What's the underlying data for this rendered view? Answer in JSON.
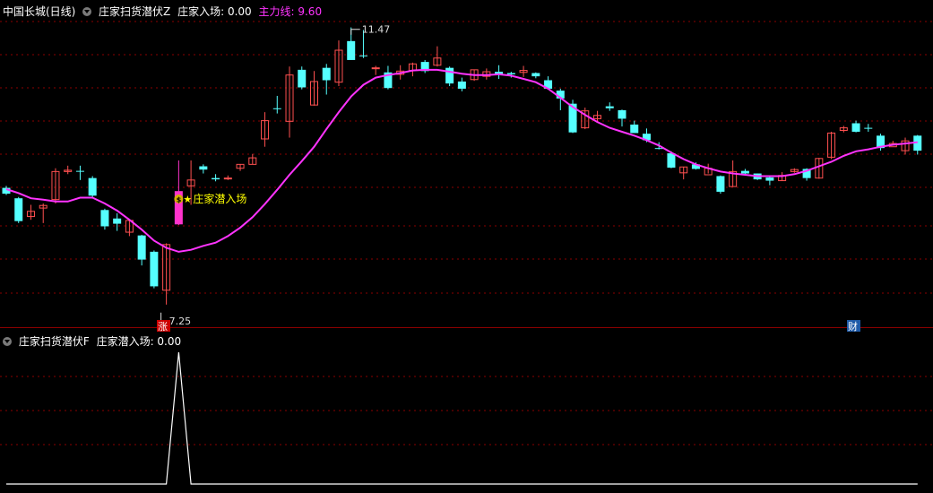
{
  "main_header": {
    "stock": "中国长城(日线)",
    "indicator": "庄家扫货潜伏Z",
    "entry_label": "庄家入场: 0.00",
    "mainline_label": "主力线: 9.60"
  },
  "sub_header": {
    "indicator": "庄家扫货潜伏F",
    "entry_label": "庄家潜入场: 0.00"
  },
  "markers": {
    "high_label": "11.47",
    "low_label": "7.25",
    "signal_label": "庄家潜入场",
    "star": "★",
    "money_glyph": "$",
    "zhang_badge": "涨",
    "cai_badge": "财"
  },
  "colors": {
    "background": "#000000",
    "grid": "#8b0000",
    "up": "#ff5050",
    "down": "#55ffff",
    "mainline": "#ff33ff",
    "signal_text": "#ffff00",
    "signal_candle": "#ff33cc",
    "sub_line": "#ffffff"
  },
  "chart_data": [
    {
      "type": "candlestick",
      "title": "中国长城(日线)",
      "y_range": [
        7.0,
        11.7
      ],
      "high_value": 11.47,
      "low_value": 7.25,
      "candles": [
        [
          9.04,
          8.95,
          9.07,
          8.93
        ],
        [
          8.88,
          8.53,
          8.9,
          8.5
        ],
        [
          8.6,
          8.68,
          8.78,
          8.55
        ],
        [
          8.73,
          8.77,
          8.8,
          8.5
        ],
        [
          8.86,
          9.29,
          9.34,
          8.8
        ],
        [
          9.29,
          9.31,
          9.38,
          9.25
        ],
        [
          9.3,
          9.29,
          9.38,
          9.16
        ],
        [
          9.19,
          8.92,
          9.22,
          8.9
        ],
        [
          8.7,
          8.45,
          8.72,
          8.4
        ],
        [
          8.57,
          8.49,
          8.65,
          8.38
        ],
        [
          8.36,
          8.54,
          8.55,
          8.3
        ],
        [
          8.31,
          7.94,
          8.32,
          7.85
        ],
        [
          8.06,
          7.53,
          8.08,
          7.5
        ],
        [
          7.47,
          8.17,
          8.19,
          7.25
        ],
        [
          8.48,
          8.99,
          9.46,
          8.47
        ],
        [
          9.07,
          9.16,
          9.46,
          8.78
        ],
        [
          9.37,
          9.32,
          9.4,
          9.26
        ],
        [
          9.19,
          9.17,
          9.25,
          9.14
        ],
        [
          9.19,
          9.19,
          9.23,
          9.16
        ],
        [
          9.34,
          9.4,
          9.4,
          9.3
        ],
        [
          9.4,
          9.5,
          9.56,
          9.4
        ],
        [
          9.79,
          10.07,
          10.2,
          9.67
        ],
        [
          10.26,
          10.25,
          10.45,
          10.18
        ],
        [
          10.06,
          10.77,
          10.9,
          9.81
        ],
        [
          10.85,
          10.58,
          10.9,
          10.55
        ],
        [
          10.31,
          10.67,
          10.83,
          10.3
        ],
        [
          10.88,
          10.69,
          10.94,
          10.47
        ],
        [
          10.66,
          11.15,
          11.3,
          10.6
        ],
        [
          11.29,
          11.0,
          11.5,
          11.0
        ],
        [
          11.07,
          11.06,
          11.46,
          11.03
        ],
        [
          10.88,
          10.88,
          10.91,
          10.77
        ],
        [
          10.81,
          10.57,
          10.91,
          10.55
        ],
        [
          10.78,
          10.83,
          10.92,
          10.7
        ],
        [
          10.84,
          10.94,
          10.96,
          10.75
        ],
        [
          10.97,
          10.83,
          11.0,
          10.8
        ],
        [
          10.92,
          11.03,
          11.21,
          10.9
        ],
        [
          10.88,
          10.64,
          10.9,
          10.6
        ],
        [
          10.67,
          10.56,
          10.73,
          10.52
        ],
        [
          10.7,
          10.85,
          10.85,
          10.68
        ],
        [
          10.75,
          10.82,
          10.87,
          10.7
        ],
        [
          10.82,
          10.77,
          10.92,
          10.71
        ],
        [
          10.8,
          10.78,
          10.82,
          10.73
        ],
        [
          10.81,
          10.84,
          10.91,
          10.74
        ],
        [
          10.8,
          10.75,
          10.81,
          10.72
        ],
        [
          10.69,
          10.56,
          10.75,
          10.55
        ],
        [
          10.53,
          10.41,
          10.56,
          10.23
        ],
        [
          10.33,
          9.89,
          10.39,
          9.88
        ],
        [
          9.96,
          10.22,
          10.27,
          9.94
        ],
        [
          10.1,
          10.15,
          10.22,
          10.05
        ],
        [
          10.29,
          10.26,
          10.35,
          10.22
        ],
        [
          10.23,
          10.1,
          10.24,
          9.98
        ],
        [
          10.01,
          9.88,
          10.07,
          9.88
        ],
        [
          9.87,
          9.77,
          9.95,
          9.74
        ],
        [
          9.65,
          9.64,
          9.74,
          9.63
        ],
        [
          9.57,
          9.35,
          9.6,
          9.34
        ],
        [
          9.27,
          9.36,
          9.36,
          9.17
        ],
        [
          9.4,
          9.33,
          9.43,
          9.32
        ],
        [
          9.24,
          9.34,
          9.41,
          9.26
        ],
        [
          9.22,
          8.98,
          9.23,
          8.95
        ],
        [
          9.06,
          9.29,
          9.46,
          9.06
        ],
        [
          9.3,
          9.26,
          9.33,
          9.24
        ],
        [
          9.26,
          9.17,
          9.26,
          9.16
        ],
        [
          9.2,
          9.15,
          9.22,
          9.08
        ],
        [
          9.15,
          9.23,
          9.28,
          9.15
        ],
        [
          9.29,
          9.32,
          9.34,
          9.27
        ],
        [
          9.33,
          9.19,
          9.34,
          9.15
        ],
        [
          9.19,
          9.49,
          9.5,
          9.18
        ],
        [
          9.51,
          9.88,
          9.9,
          9.48
        ],
        [
          9.92,
          9.96,
          9.99,
          9.89
        ],
        [
          10.03,
          9.9,
          10.07,
          9.89
        ],
        [
          9.96,
          9.95,
          10.02,
          9.9
        ],
        [
          9.84,
          9.65,
          9.87,
          9.61
        ],
        [
          9.67,
          9.72,
          9.76,
          9.7
        ],
        [
          9.61,
          9.76,
          9.81,
          9.55
        ],
        [
          9.84,
          9.61,
          9.85,
          9.55
        ]
      ],
      "mainline": [
        9.02,
        8.96,
        8.88,
        8.86,
        8.83,
        8.83,
        8.89,
        8.89,
        8.8,
        8.69,
        8.55,
        8.4,
        8.23,
        8.12,
        8.06,
        8.09,
        8.15,
        8.2,
        8.3,
        8.43,
        8.59,
        8.79,
        9.01,
        9.24,
        9.45,
        9.67,
        9.94,
        10.2,
        10.44,
        10.62,
        10.73,
        10.77,
        10.8,
        10.84,
        10.85,
        10.85,
        10.82,
        10.79,
        10.77,
        10.77,
        10.78,
        10.76,
        10.71,
        10.66,
        10.56,
        10.42,
        10.28,
        10.16,
        10.05,
        9.96,
        9.9,
        9.84,
        9.77,
        9.69,
        9.58,
        9.48,
        9.4,
        9.34,
        9.29,
        9.26,
        9.24,
        9.22,
        9.22,
        9.22,
        9.25,
        9.3,
        9.37,
        9.44,
        9.53,
        9.6,
        9.63,
        9.67,
        9.7,
        9.72,
        9.74
      ]
    },
    {
      "type": "line",
      "title": "庄家扫货潜伏F",
      "y_range": [
        0,
        1
      ],
      "values": [
        0,
        0,
        0,
        0,
        0,
        0,
        0,
        0,
        0,
        0,
        0,
        0,
        0,
        0,
        1,
        0,
        0,
        0,
        0,
        0,
        0,
        0,
        0,
        0,
        0,
        0,
        0,
        0,
        0,
        0,
        0,
        0,
        0,
        0,
        0,
        0,
        0,
        0,
        0,
        0,
        0,
        0,
        0,
        0,
        0,
        0,
        0,
        0,
        0,
        0,
        0,
        0,
        0,
        0,
        0,
        0,
        0,
        0,
        0,
        0,
        0,
        0,
        0,
        0,
        0,
        0,
        0,
        0,
        0,
        0,
        0,
        0,
        0,
        0,
        0
      ]
    }
  ]
}
